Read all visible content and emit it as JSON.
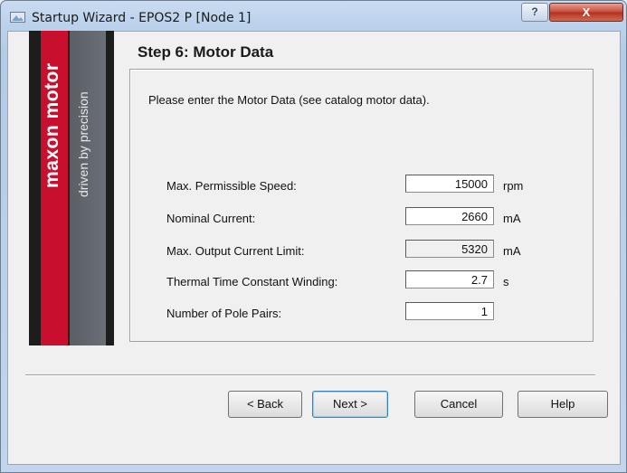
{
  "window": {
    "title": "Startup Wizard - EPOS2 P [Node 1]",
    "help_glyph": "?",
    "close_glyph": "X"
  },
  "banner": {
    "brand": "maxon motor",
    "tagline": "driven by precision",
    "brand_color": "#c8102e"
  },
  "step": {
    "title": "Step 6: Motor Data",
    "intro": "Please enter the Motor Data (see catalog motor data)."
  },
  "fields": [
    {
      "label": "Max. Permissible Speed:",
      "value": "15000",
      "unit": "rpm"
    },
    {
      "label": "Nominal Current:",
      "value": "2660",
      "unit": "mA"
    },
    {
      "label": "Max. Output Current Limit:",
      "value": "5320",
      "unit": "mA"
    },
    {
      "label": "Thermal Time Constant Winding:",
      "value": "2.7",
      "unit": "s"
    },
    {
      "label": "Number of Pole Pairs:",
      "value": "1",
      "unit": ""
    }
  ],
  "buttons": {
    "back": "< Back",
    "next": "Next >",
    "cancel": "Cancel",
    "help": "Help"
  }
}
